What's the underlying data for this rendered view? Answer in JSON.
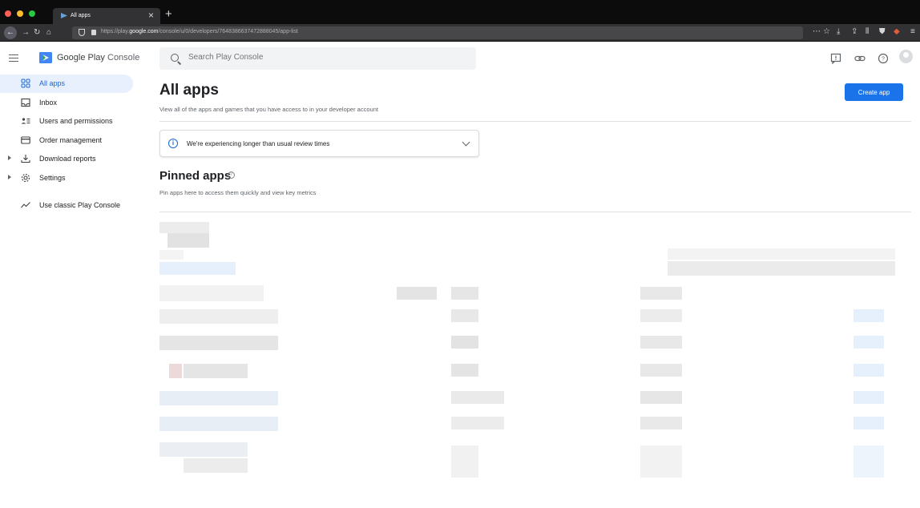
{
  "browser": {
    "tab_title": "All apps",
    "url_prefix": "https://play.",
    "url_domain": "google.com",
    "url_path": "/console/u/0/developers/7648386637472888045/app-list"
  },
  "header": {
    "brand_first": "Google Play",
    "brand_second": "Console",
    "search_placeholder": "Search Play Console"
  },
  "sidebar": {
    "items": [
      {
        "label": "All apps"
      },
      {
        "label": "Inbox"
      },
      {
        "label": "Users and permissions"
      },
      {
        "label": "Order management"
      },
      {
        "label": "Download reports"
      },
      {
        "label": "Settings"
      },
      {
        "label": "Use classic Play Console"
      }
    ]
  },
  "main": {
    "title": "All apps",
    "subtitle": "View all of the apps and games that you have access to in your developer account",
    "create_label": "Create app",
    "notice_text": "We're experiencing longer than usual review times",
    "pinned_title": "Pinned apps",
    "pinned_subtitle": "Pin apps here to access them quickly and view key metrics"
  },
  "colors": {
    "accent": "#1a73e8",
    "active_bg": "#e8f0fe",
    "active_text": "#1967d2"
  }
}
